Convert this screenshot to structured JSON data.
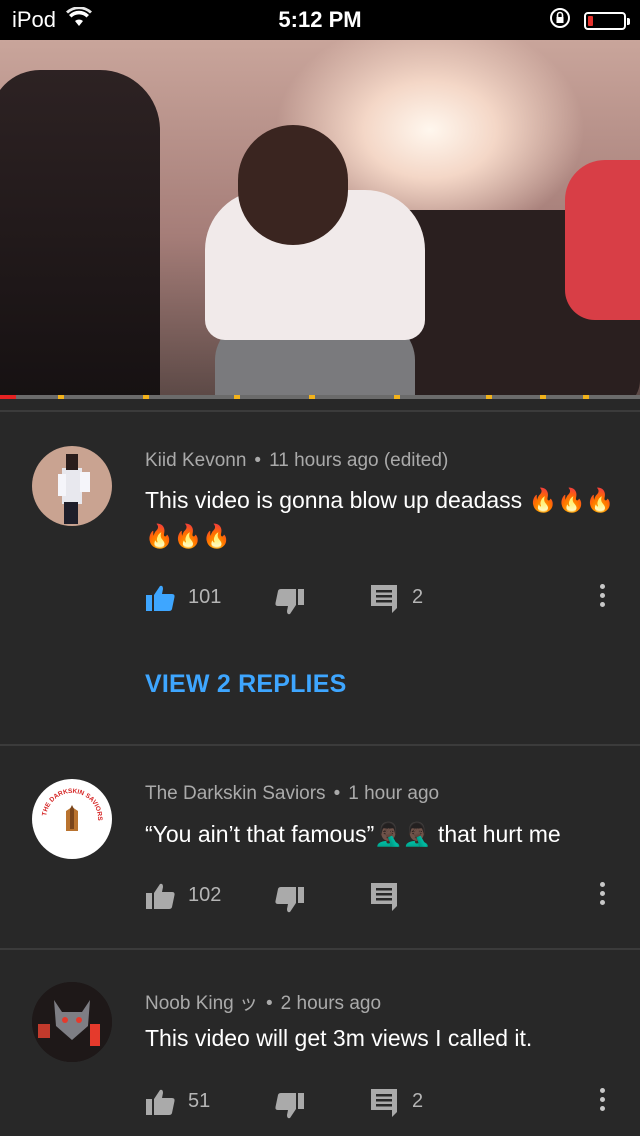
{
  "status_bar": {
    "carrier": "iPod",
    "time": "5:12 PM"
  },
  "video": {
    "progress_fraction": 0.025
  },
  "comments": [
    {
      "author": "Kiid Kevonn",
      "separator": "•",
      "time": "11 hours ago (edited)",
      "text": "This video is gonna blow up deadass 🔥🔥🔥🔥🔥🔥",
      "likes": "101",
      "replies": "2",
      "like_active": true,
      "view_replies": "VIEW 2 REPLIES"
    },
    {
      "author": "The Darkskin Saviors",
      "separator": "•",
      "time": "1 hour ago",
      "text": "“You ain’t that famous”🤦🏿‍♂️🤦🏿‍♂️ that hurt me",
      "likes": "102",
      "replies": "",
      "like_active": false,
      "avatar_text": "THE DARKSKIN SAVIORS"
    },
    {
      "author": "Noob King ッ",
      "separator": "•",
      "time": "2 hours ago",
      "text": "This video will get 3m views I called it.",
      "likes": "51",
      "replies": "2",
      "like_active": false
    }
  ],
  "colors": {
    "background": "#282828",
    "accent_blue": "#3ea6ff",
    "progress_red": "#e52222",
    "ad_marker": "#f2b21b"
  },
  "icons": [
    "wifi-icon",
    "orientation-lock-icon",
    "battery-icon",
    "thumbs-up-icon",
    "thumbs-down-icon",
    "reply-icon",
    "more-vert-icon"
  ]
}
